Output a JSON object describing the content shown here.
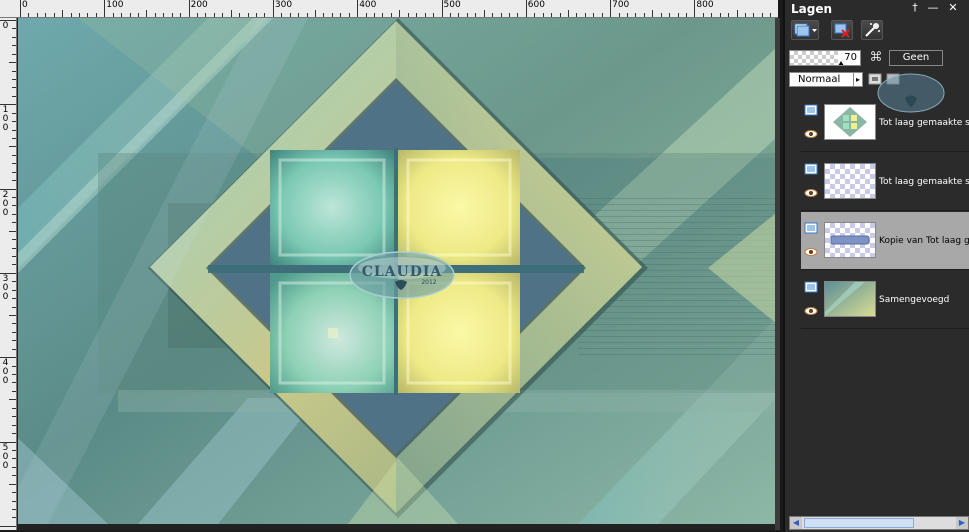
{
  "ruler": {
    "top_labels": [
      "0",
      "100",
      "200",
      "300",
      "400",
      "500",
      "600",
      "700",
      "800"
    ],
    "left_labels": [
      "0",
      "1\n0\n0",
      "2\n0\n0",
      "3\n0\n0",
      "4\n0\n0",
      "5\n0\n0"
    ]
  },
  "canvas": {
    "watermark_text": "CLAUDIA",
    "watermark_sub": "2012"
  },
  "panel": {
    "title": "Lagen",
    "title_buttons": {
      "pin": "†",
      "minimize": "—",
      "close": "✕"
    },
    "opacity": {
      "value": "70",
      "link_name": "Geen"
    },
    "blend_mode": "Normaal",
    "layers": [
      {
        "name": "Tot laag gemaakte sel",
        "selected": false,
        "thumb": "diamond"
      },
      {
        "name": "Tot laag gemaakte sel",
        "selected": false,
        "thumb": "transparent"
      },
      {
        "name": "Kopie van Tot laag ge",
        "selected": true,
        "thumb": "bar"
      },
      {
        "name": "Samengevoegd",
        "selected": false,
        "thumb": "merged"
      }
    ]
  },
  "colors": {
    "panel_bg": "#2b2b2b",
    "selected_row": "#a8a8a8",
    "canvas_teal": "#4d8088",
    "canvas_yellow": "#f6f08a",
    "canvas_mint": "#8fd6b2",
    "canvas_slate": "#4e6e8a"
  }
}
